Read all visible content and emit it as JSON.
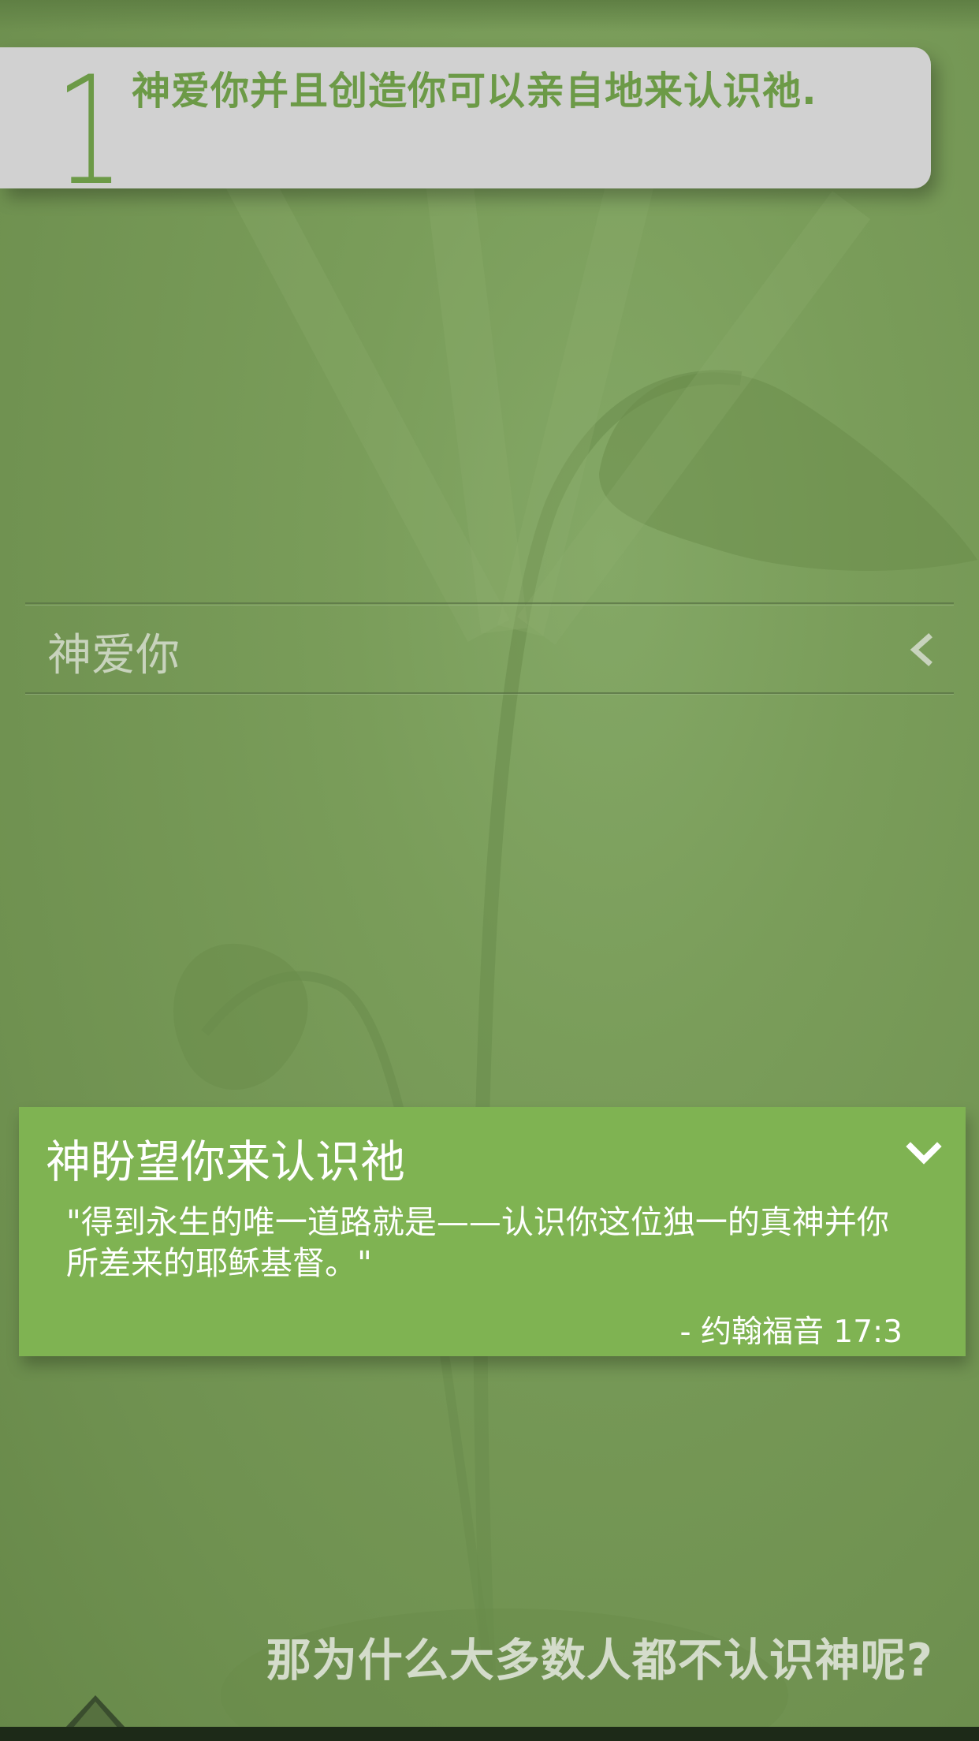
{
  "step": {
    "number": "1",
    "title": "神爱你并且创造你可以亲自地来认识祂."
  },
  "accordion": {
    "collapsed_label": "神爱你",
    "collapsed_icon": "chevron-left-icon",
    "expanded": {
      "title": "神盼望你来认识祂",
      "toggle_icon": "chevron-down-icon",
      "verse": "\"得到永生的唯一道路就是——认识你这位独一的真神并你所差来的耶稣基督。\"",
      "reference": "- 约翰福音 17:3"
    }
  },
  "next_prompt": "那为什么大多数人都不认识神呢?",
  "colors": {
    "background": "#739652",
    "card_header": "#d1d1d1",
    "accent_green": "#6c9a47",
    "expanded_card": "#7fb352"
  }
}
